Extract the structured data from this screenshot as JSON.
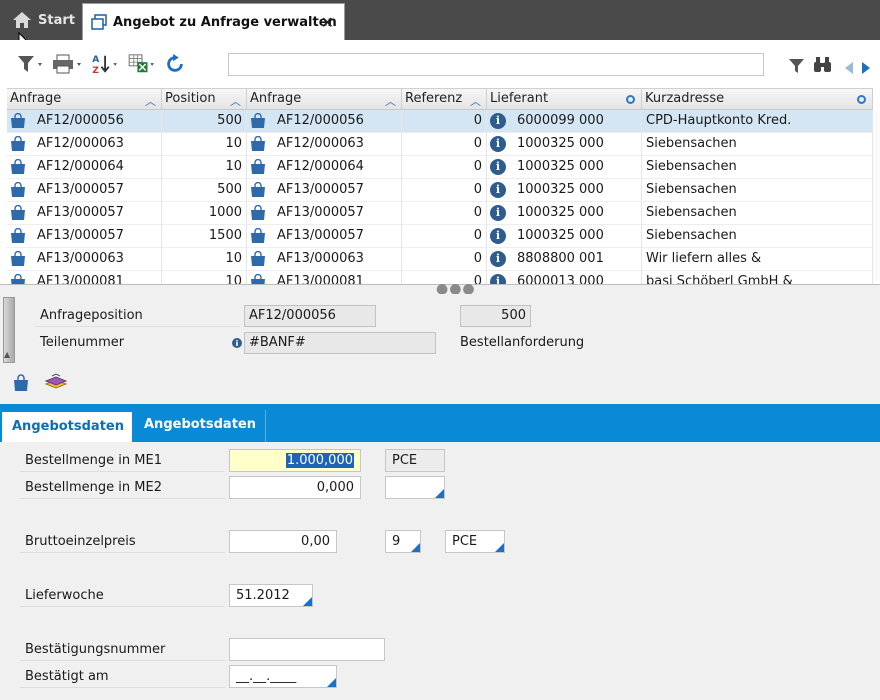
{
  "tabs": {
    "start_label": "Start",
    "active_label": "Angebot zu Anfrage verwalten"
  },
  "toolbar": {
    "search_value": ""
  },
  "grid": {
    "headers": [
      "Anfrage",
      "Position",
      "Anfrage",
      "Referenz",
      "Lieferant",
      "Kurzadresse"
    ],
    "rows": [
      {
        "anfrage": "AF12/000056",
        "position": "500",
        "anfrage2": "AF12/000056",
        "referenz": "0",
        "lieferant": "6000099 000",
        "kurzadresse": "CPD-Hauptkonto Kred."
      },
      {
        "anfrage": "AF12/000063",
        "position": "10",
        "anfrage2": "AF12/000063",
        "referenz": "0",
        "lieferant": "1000325 000",
        "kurzadresse": "Siebensachen"
      },
      {
        "anfrage": "AF12/000064",
        "position": "10",
        "anfrage2": "AF12/000064",
        "referenz": "0",
        "lieferant": "1000325 000",
        "kurzadresse": "Siebensachen"
      },
      {
        "anfrage": "AF13/000057",
        "position": "500",
        "anfrage2": "AF13/000057",
        "referenz": "0",
        "lieferant": "1000325 000",
        "kurzadresse": "Siebensachen"
      },
      {
        "anfrage": "AF13/000057",
        "position": "1000",
        "anfrage2": "AF13/000057",
        "referenz": "0",
        "lieferant": "1000325 000",
        "kurzadresse": "Siebensachen"
      },
      {
        "anfrage": "AF13/000057",
        "position": "1500",
        "anfrage2": "AF13/000057",
        "referenz": "0",
        "lieferant": "1000325 000",
        "kurzadresse": "Siebensachen"
      },
      {
        "anfrage": "AF13/000063",
        "position": "10",
        "anfrage2": "AF13/000063",
        "referenz": "0",
        "lieferant": "8808800 001",
        "kurzadresse": "Wir liefern alles &"
      },
      {
        "anfrage": "AF13/000081",
        "position": "10",
        "anfrage2": "AF13/000081",
        "referenz": "0",
        "lieferant": "6000013 000",
        "kurzadresse": "basi Schöberl GmbH &"
      }
    ]
  },
  "details": {
    "anfrageposition_label": "Anfrageposition",
    "anfrageposition_value": "AF12/000056",
    "position_value": "500",
    "teilenummer_label": "Teilenummer",
    "teilenummer_value": "#BANF#",
    "bestellanforderung_label": "Bestellanforderung"
  },
  "form_tabs": {
    "tab1": "Angebotsdaten 1",
    "tab2": "Angebotsdaten 2"
  },
  "form": {
    "bestellmenge_me1_label": "Bestellmenge in ME1",
    "bestellmenge_me1_value": "1.000,000",
    "me1_unit": "PCE",
    "bestellmenge_me2_label": "Bestellmenge in ME2",
    "bestellmenge_me2_value": "0,000",
    "me2_unit": "",
    "bruttoeinzelpreis_label": "Bruttoeinzelpreis",
    "bruttoeinzelpreis_value": "0,00",
    "preiseinheit_value": "9",
    "preis_unit": "PCE",
    "lieferwoche_label": "Lieferwoche",
    "lieferwoche_value": "51.2012",
    "bestaetigungsnummer_label": "Bestätigungsnummer",
    "bestaetigungsnummer_value": "",
    "bestaetigt_am_label": "Bestätigt am",
    "bestaetigt_am_value": "__.__.____"
  },
  "colors": {
    "accent_blue": "#0a89d6",
    "selection": "#d4e6f4",
    "highlight_input": "#ffffcc"
  }
}
